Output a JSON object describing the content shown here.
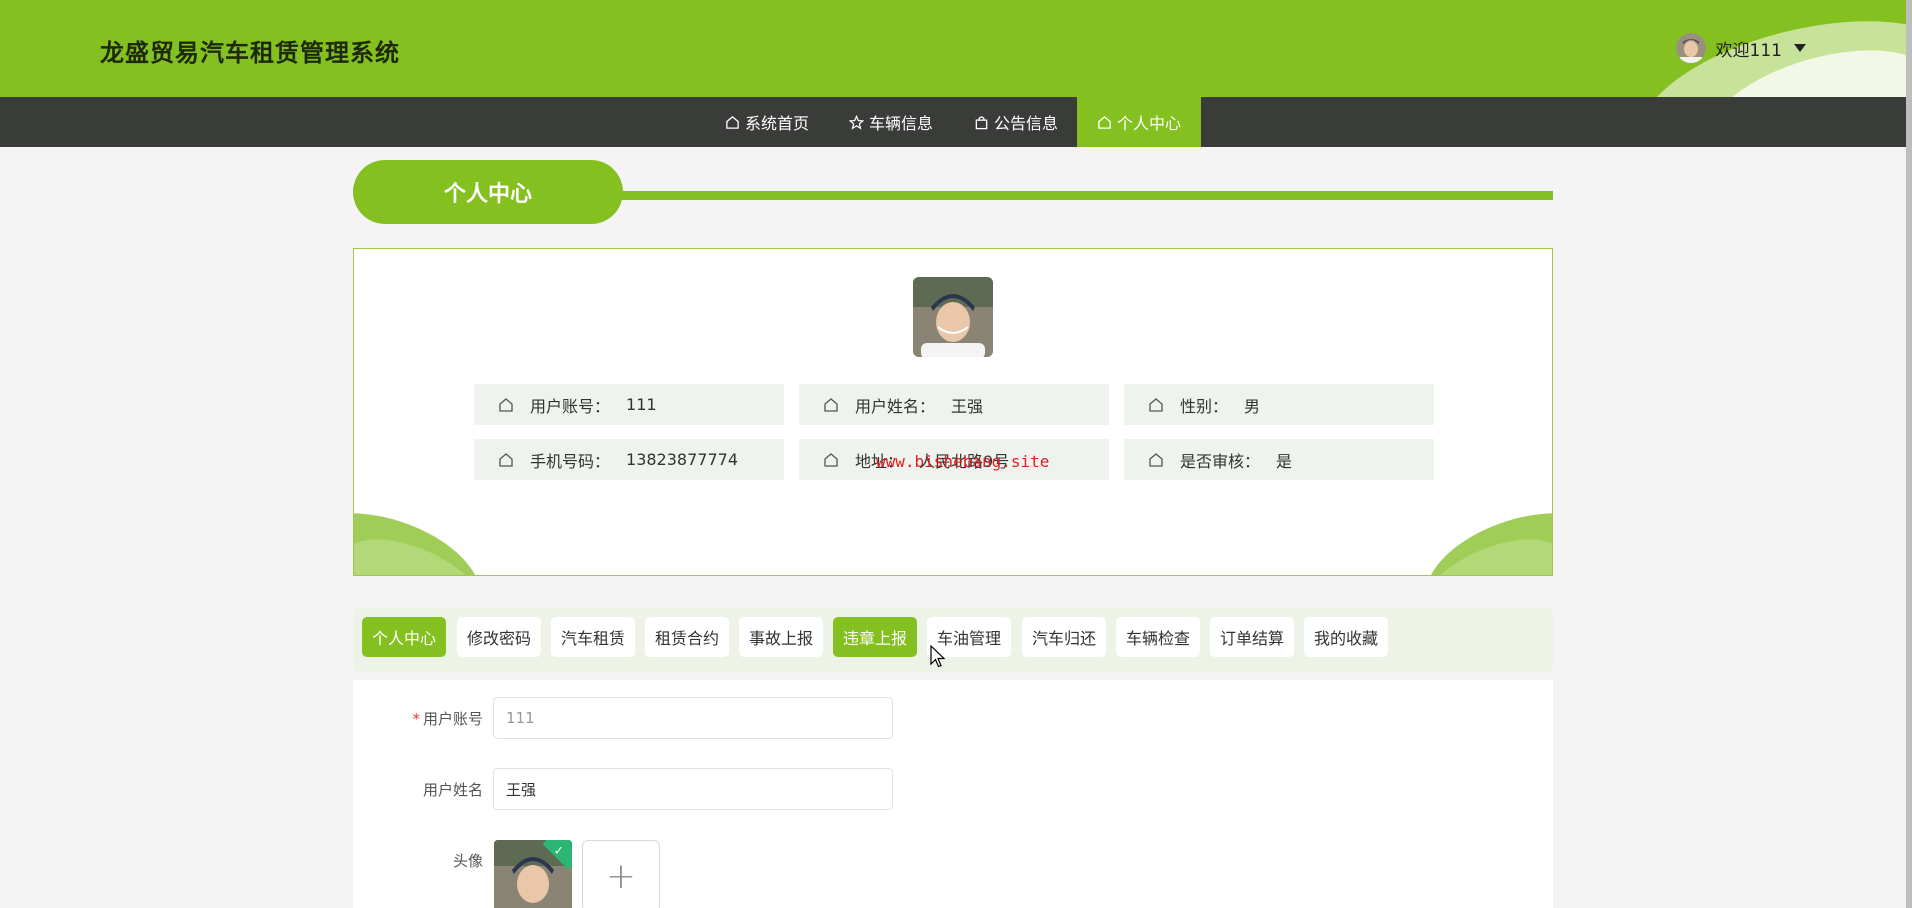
{
  "header": {
    "title": "龙盛贸易汽车租赁管理系统",
    "welcome": "欢迎111",
    "accent_color": "#84c020"
  },
  "nav": {
    "items": [
      {
        "label": "系统首页",
        "icon": "home-icon"
      },
      {
        "label": "车辆信息",
        "icon": "star-icon"
      },
      {
        "label": "公告信息",
        "icon": "bag-icon"
      },
      {
        "label": "个人中心",
        "icon": "home-icon",
        "active": true
      }
    ]
  },
  "section": {
    "title": "个人中心"
  },
  "profile": {
    "fields": [
      {
        "label": "用户账号：",
        "value": "111"
      },
      {
        "label": "用户姓名：",
        "value": "王强"
      },
      {
        "label": "性别：",
        "value": "男"
      },
      {
        "label": "手机号码：",
        "value": "13823877774"
      },
      {
        "label": "地址：",
        "value": "人民北路9号"
      },
      {
        "label": "是否审核：",
        "value": "是"
      }
    ],
    "watermark": "www.bishebang.site"
  },
  "tabs": [
    {
      "label": "个人中心",
      "active": true
    },
    {
      "label": "修改密码"
    },
    {
      "label": "汽车租赁"
    },
    {
      "label": "租赁合约"
    },
    {
      "label": "事故上报"
    },
    {
      "label": "违章上报",
      "hover": true
    },
    {
      "label": "车油管理"
    },
    {
      "label": "汽车归还"
    },
    {
      "label": "车辆检查"
    },
    {
      "label": "订单结算"
    },
    {
      "label": "我的收藏"
    }
  ],
  "form": {
    "account_label": "用户账号",
    "account_required_mark": "*",
    "account_value": "111",
    "name_label": "用户姓名",
    "name_value": "王强",
    "avatar_label": "头像",
    "upload_symbol": "+",
    "check_symbol": "✓"
  }
}
